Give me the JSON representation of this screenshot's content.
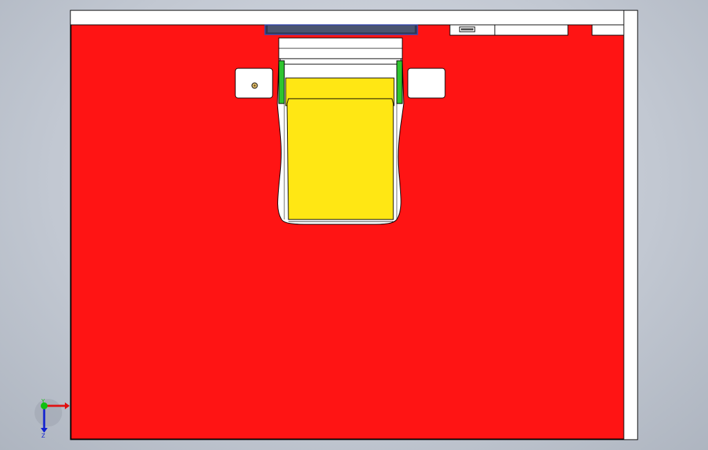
{
  "viewport": {
    "background_top": "#d9dde5",
    "background_bottom": "#aeb5c0"
  },
  "model": {
    "base_plate_color": "#ff1414",
    "frame_color": "#ffffff",
    "seat_color": "#ffe714",
    "seat_guide_color": "#2fc42f",
    "monitor_edge_color": "#3a4bb0",
    "outline_color": "#000000"
  },
  "triad": {
    "x_axis_color": "#e01010",
    "y_axis_color": "#10c010",
    "z_axis_color": "#1020d0",
    "x_label": "",
    "y_label": "Y",
    "z_label": "Z"
  }
}
